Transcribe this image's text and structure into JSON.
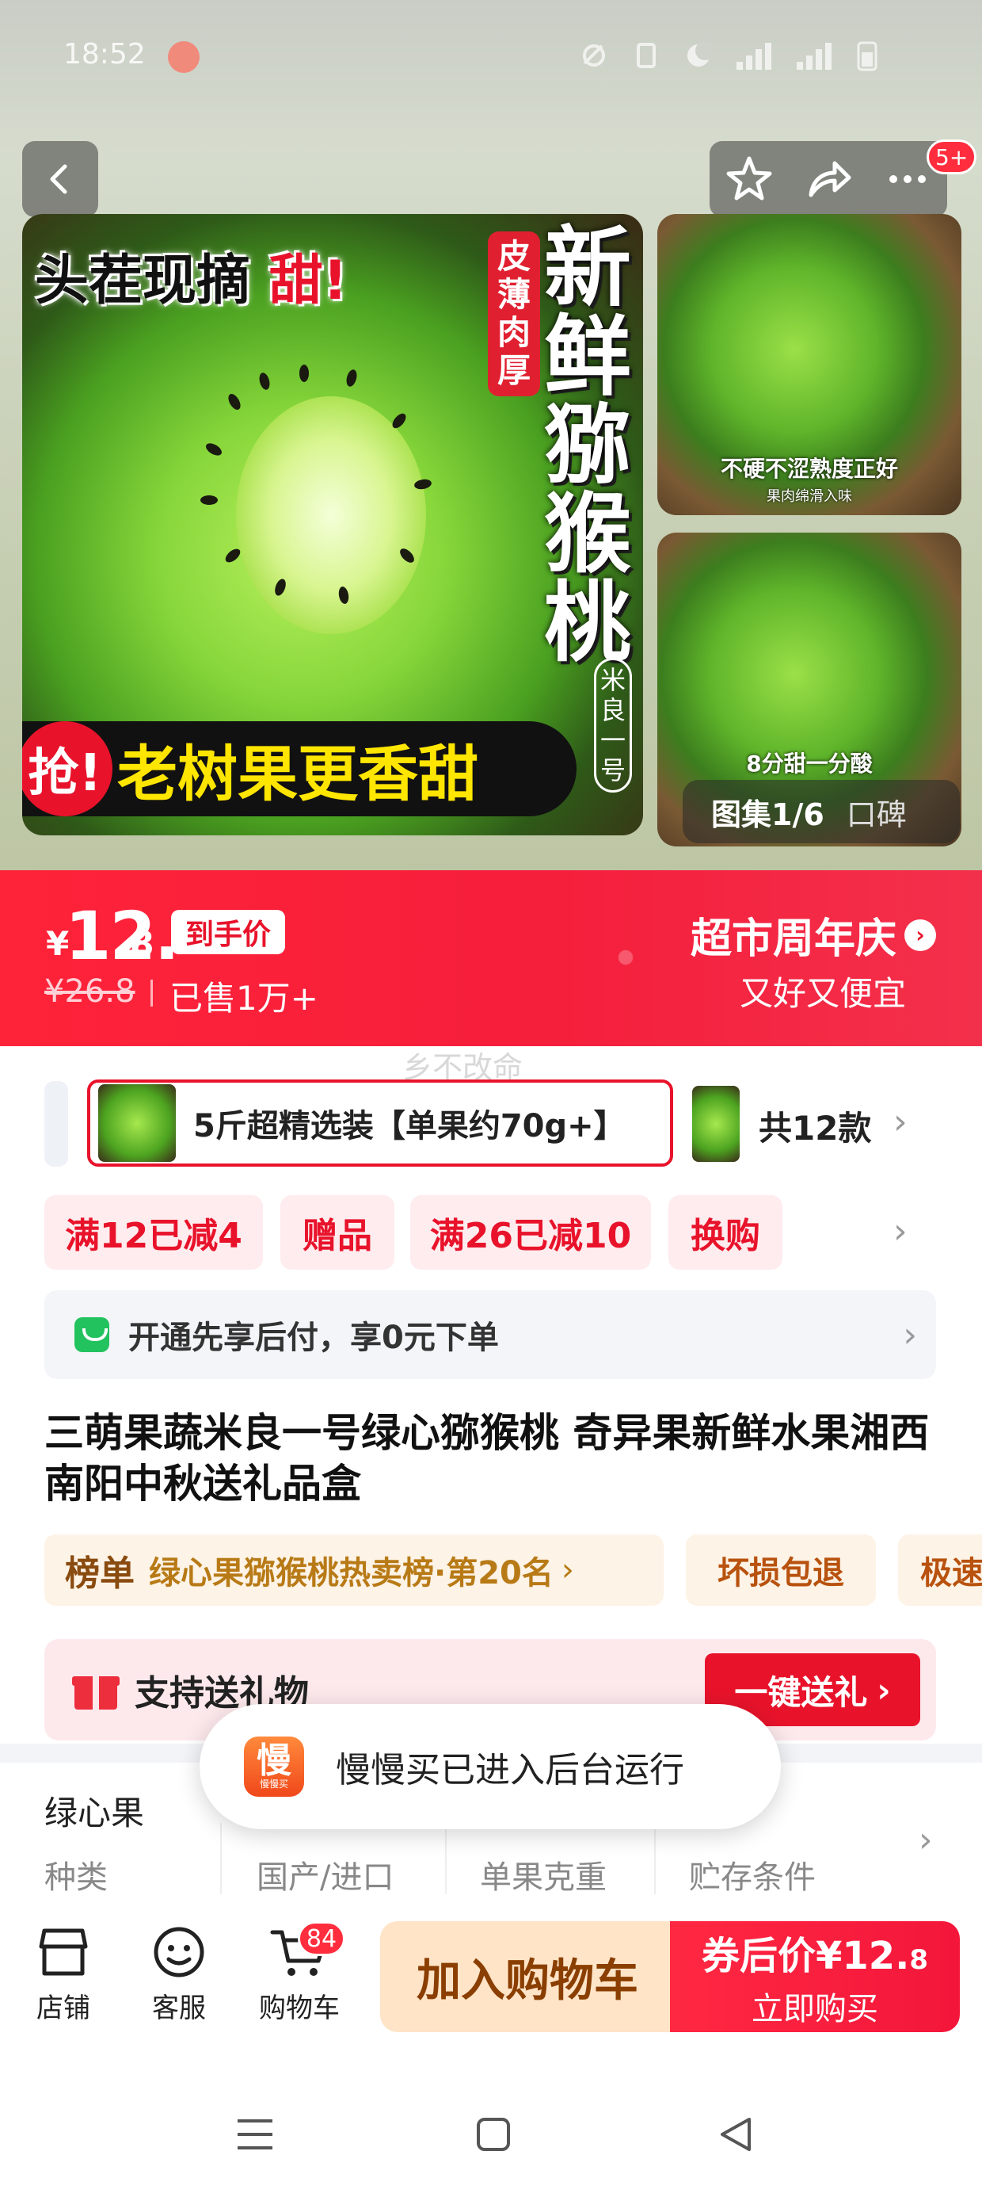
{
  "status": {
    "time": "18:52"
  },
  "hero": {
    "notification_badge": "5+",
    "main_headline_black": "头茬现摘",
    "main_headline_red": "甜!",
    "thin_skin_tag": "皮薄肉厚",
    "vertical_title": "新鲜猕猴桃",
    "variety_tag": "米良一号",
    "grab_badge": "抢!",
    "bottom_slogan": "老树果更香甜",
    "thumb_top_caption": "不硬不涩熟度正好",
    "thumb_top_subcaption": "果肉绵滑入味",
    "thumb_bottom_caption": "8分甜一分酸",
    "gallery_label": "图集1/6",
    "koubei_label": "口碑"
  },
  "price": {
    "currency": "¥",
    "integer": "12.",
    "decimal": "8",
    "final_tag": "到手价",
    "original": "¥26.8",
    "sold": "已售1万+",
    "festival_title": "超市周年庆",
    "festival_sub": "又好又便宜",
    "watermark": "乡不改命"
  },
  "sku": {
    "selected_name": "5斤超精选装【单果约70g+】",
    "count": "共12款"
  },
  "promos": [
    "满12已减4",
    "赠品",
    "满26已减10",
    "换购"
  ],
  "paylater": {
    "text": "开通先享后付，享0元下单"
  },
  "product_title": "三萌果蔬米良一号绿心猕猴桃 奇异果新鲜水果湘西南阳中秋送礼品盒",
  "ranking": {
    "label": "榜单",
    "text": "绿心果猕猴桃热卖榜·第20名",
    "damage": "坏损包退",
    "fast": "极速"
  },
  "gift": {
    "label": "支持送礼物",
    "button": "一键送礼"
  },
  "toast": {
    "app_icon_text": "慢",
    "app_icon_sub": "慢慢买",
    "text": "慢慢买已进入后台运行"
  },
  "specs": {
    "head_value": "绿心果",
    "labels": [
      "种类",
      "国产/进口",
      "单果克重",
      "贮存条件"
    ]
  },
  "bottom_bar": {
    "shop": "店铺",
    "service": "客服",
    "cart": "购物车",
    "cart_badge": "84",
    "add_to_cart": "加入购物车",
    "coupon_price_label": "券后价",
    "coupon_price_currency": "¥",
    "coupon_price_int": "12.",
    "coupon_price_dec": "8",
    "buy_now": "立即购买"
  }
}
